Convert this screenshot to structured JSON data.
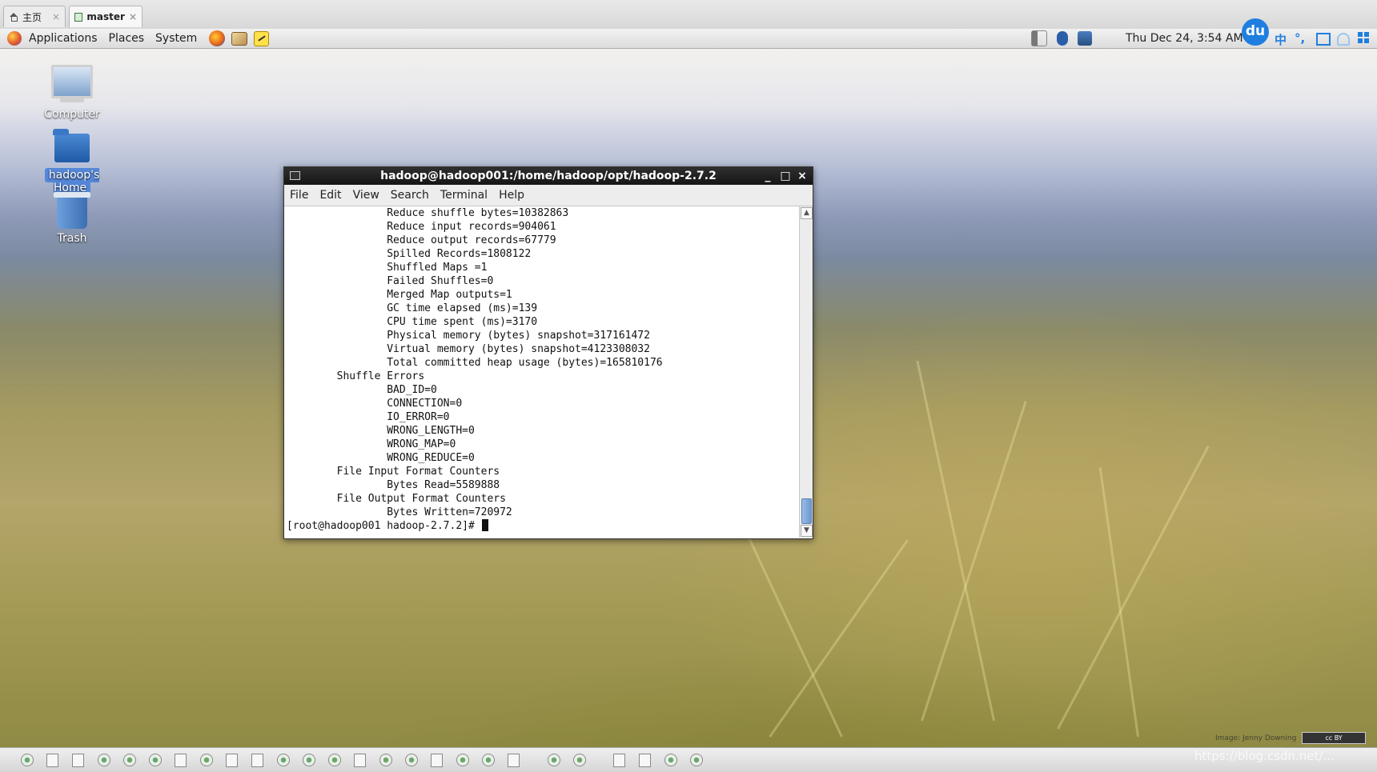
{
  "vm_tabs": [
    {
      "label": "主页",
      "close": "×"
    },
    {
      "label": "master",
      "close": "×"
    }
  ],
  "panel": {
    "menus": [
      "Applications",
      "Places",
      "System"
    ],
    "launchers": [
      "firefox-icon",
      "mail-icon",
      "note-editor-icon"
    ],
    "tray_icons": [
      "volume-icon",
      "bluetooth-icon",
      "network-icon"
    ],
    "clock": "Thu Dec 24,  3:54 AM",
    "baidu_logo": "du",
    "ime_chars": [
      "中",
      "°,"
    ]
  },
  "desktop": {
    "icons": [
      {
        "label": "Computer"
      },
      {
        "label": "hadoop's Home"
      },
      {
        "label": "Trash"
      }
    ],
    "credit": "Image: Jenny Downing",
    "cc_badge": "cc BY",
    "watermark": "https://blog.csdn.net/..."
  },
  "terminal": {
    "title": "hadoop@hadoop001:/home/hadoop/opt/hadoop-2.7.2",
    "window_buttons": [
      "_",
      "□",
      "×"
    ],
    "menu": [
      "File",
      "Edit",
      "View",
      "Search",
      "Terminal",
      "Help"
    ],
    "lines": [
      "                Reduce shuffle bytes=10382863",
      "                Reduce input records=904061",
      "                Reduce output records=67779",
      "                Spilled Records=1808122",
      "                Shuffled Maps =1",
      "                Failed Shuffles=0",
      "                Merged Map outputs=1",
      "                GC time elapsed (ms)=139",
      "                CPU time spent (ms)=3170",
      "                Physical memory (bytes) snapshot=317161472",
      "                Virtual memory (bytes) snapshot=4123308032",
      "                Total committed heap usage (bytes)=165810176",
      "        Shuffle Errors",
      "                BAD_ID=0",
      "                CONNECTION=0",
      "                IO_ERROR=0",
      "                WRONG_LENGTH=0",
      "                WRONG_MAP=0",
      "                WRONG_REDUCE=0",
      "        File Input Format Counters",
      "                Bytes Read=5589888",
      "        File Output Format Counters",
      "                Bytes Written=720972"
    ],
    "prompt": "[root@hadoop001 hadoop-2.7.2]# "
  },
  "taskbar": {
    "items": [
      "g",
      "p",
      "p",
      "g",
      "g",
      "g",
      "p",
      "g",
      "p",
      "p",
      "g",
      "g",
      "g",
      "p",
      "g",
      "g",
      "p",
      "g",
      "g",
      "p",
      "g",
      "g",
      "p",
      "p",
      "g",
      "g"
    ]
  }
}
